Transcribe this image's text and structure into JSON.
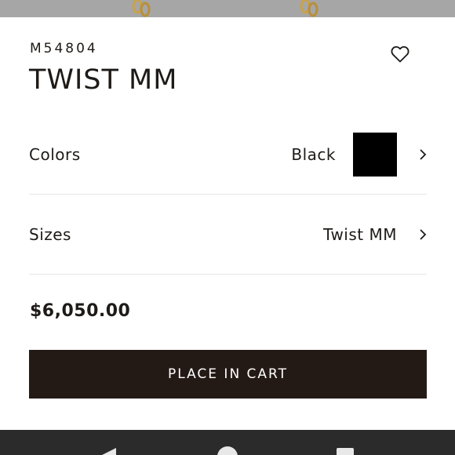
{
  "product": {
    "sku": "M54804",
    "title": "TWIST MM",
    "price": "$6,050.00"
  },
  "options": {
    "colors": {
      "label": "Colors",
      "value": "Black",
      "swatch_color": "#000000"
    },
    "sizes": {
      "label": "Sizes",
      "value": "Twist MM"
    }
  },
  "actions": {
    "cart_label": "PLACE IN CART"
  },
  "icons": {
    "wishlist": "heart-icon",
    "chevron": "chevron-right-icon",
    "nav_back": "back-triangle-icon",
    "nav_home": "home-circle-icon",
    "nav_recent": "recents-square-icon"
  },
  "colors": {
    "primary_dark": "#241a15",
    "text": "#1e1a17",
    "divider": "#e6e6e6",
    "photo_strip": "#a6a6a6",
    "navbar": "#2b2b2b"
  }
}
